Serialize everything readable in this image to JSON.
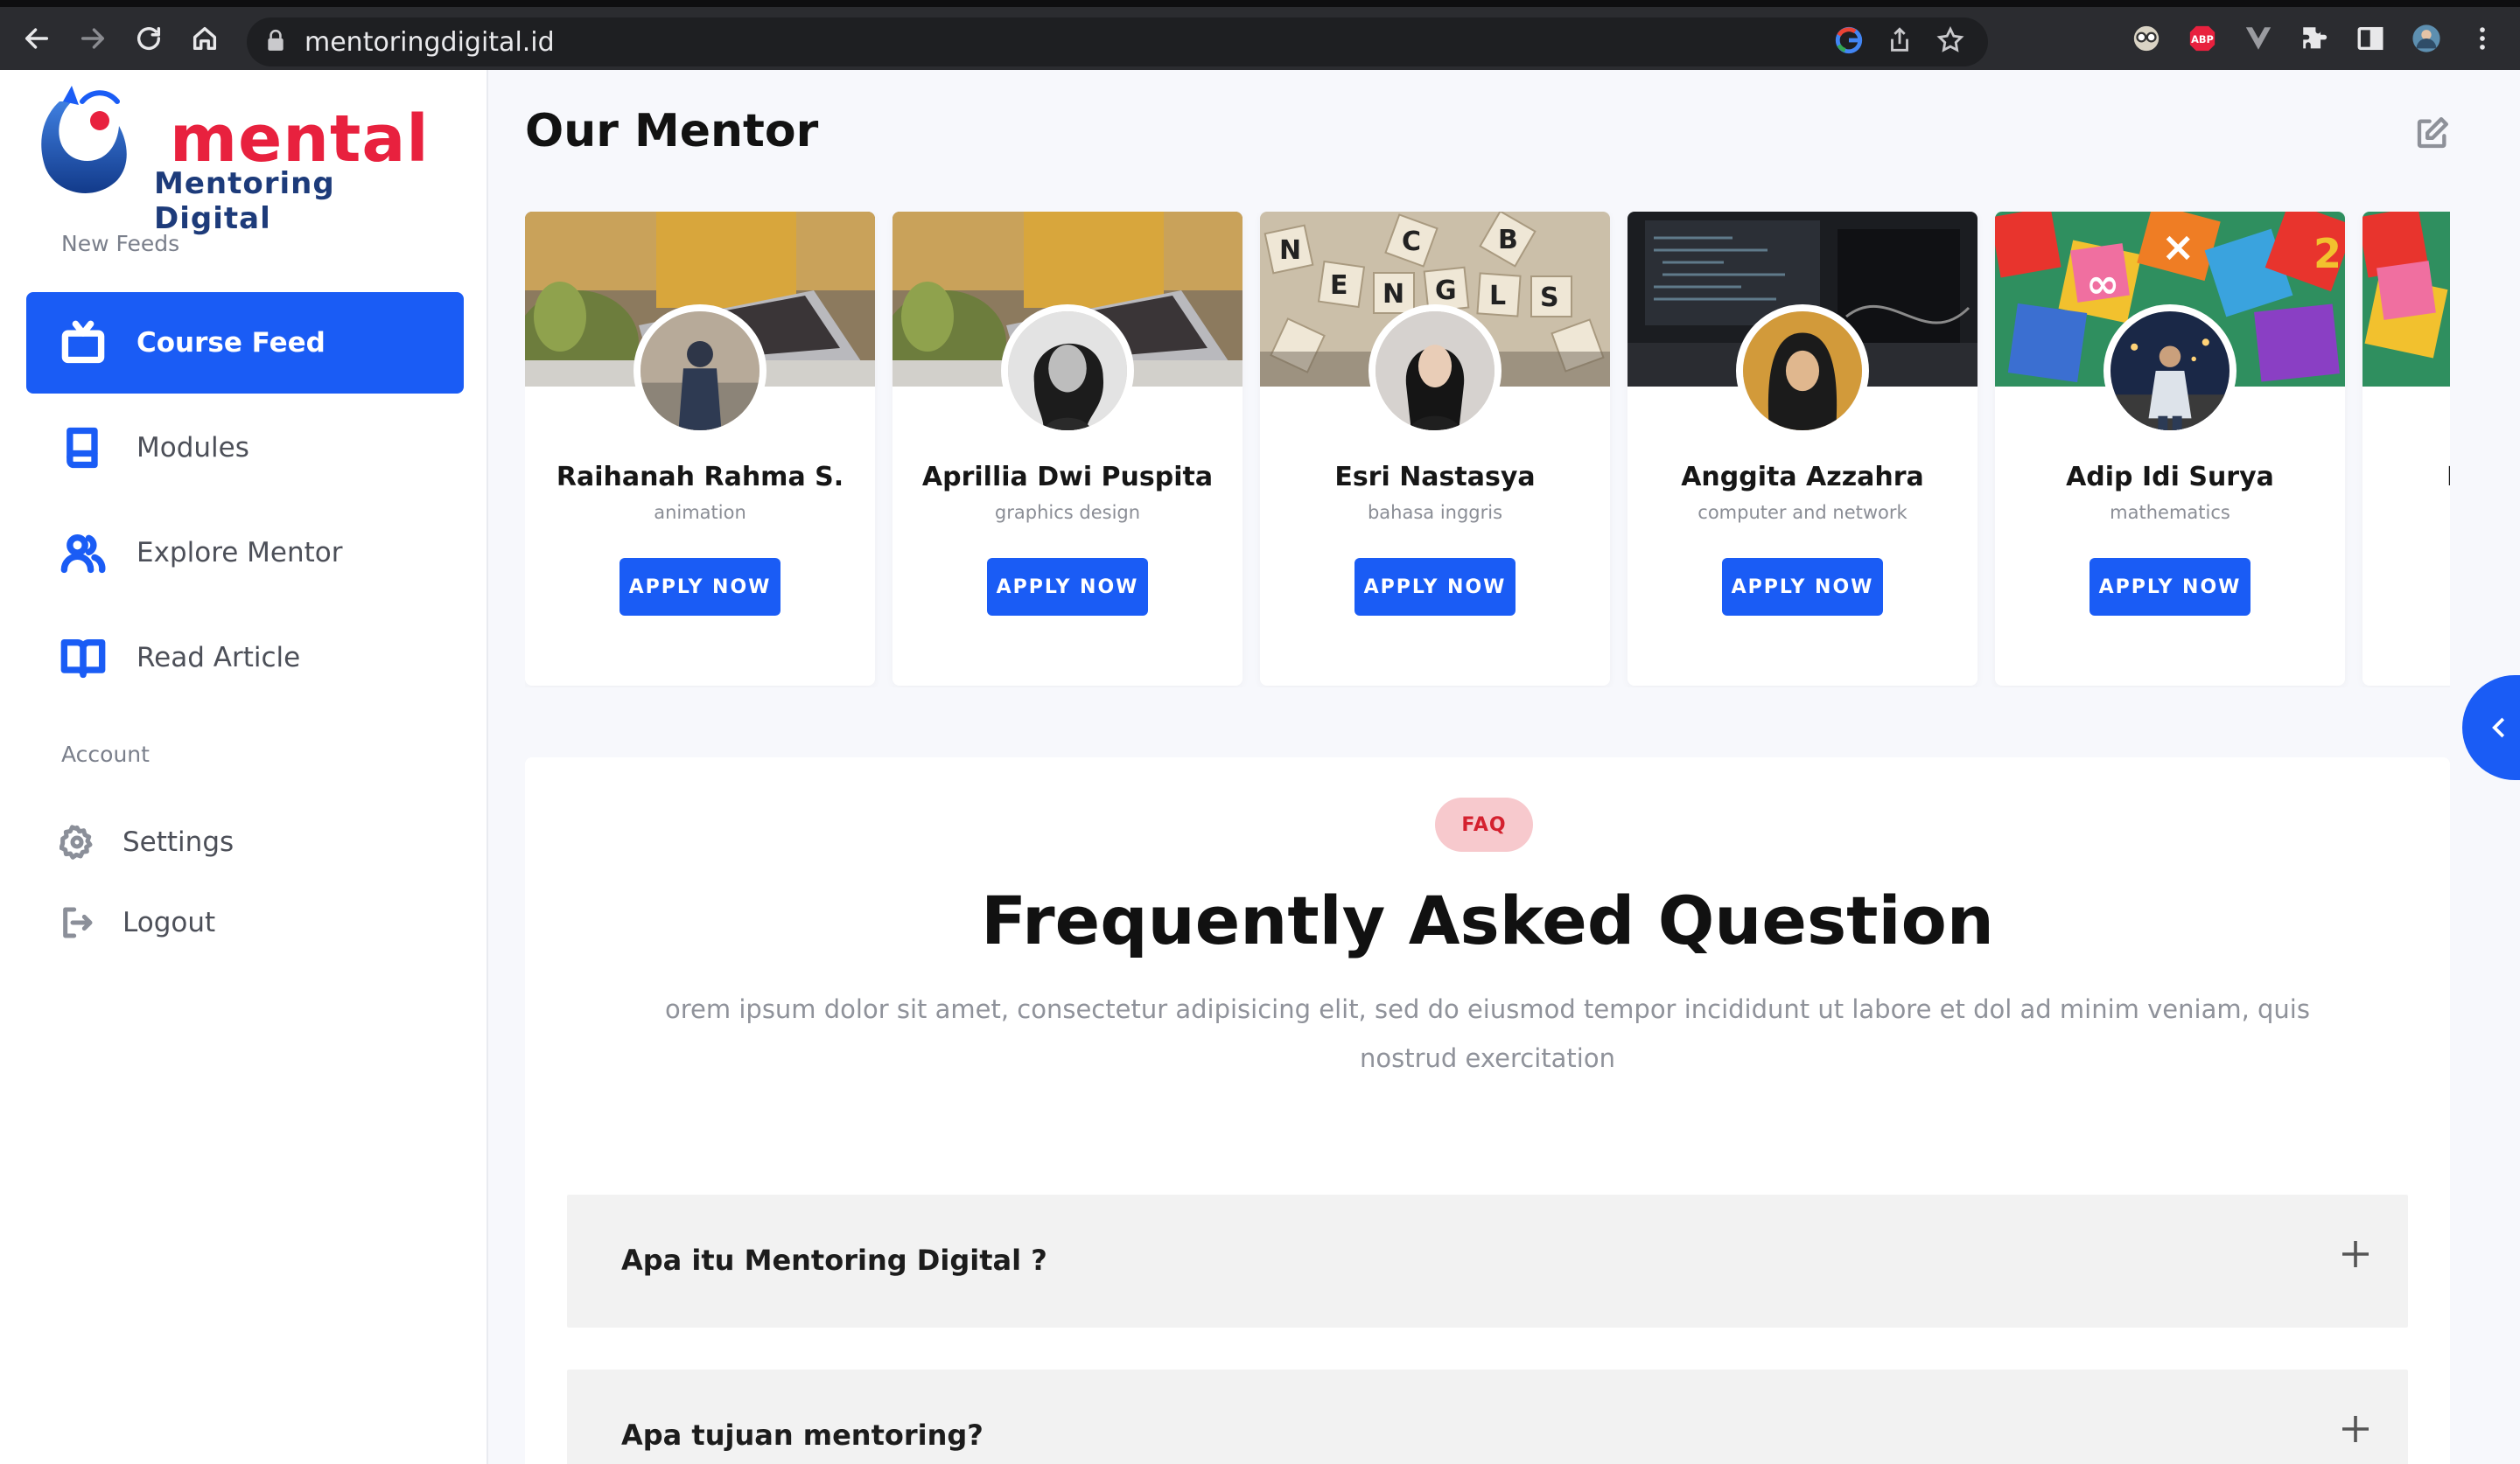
{
  "browser": {
    "url": "mentoringdigital.id"
  },
  "sidebar": {
    "logo": {
      "word": "mental",
      "sub": "Mentoring Digital"
    },
    "sections": [
      {
        "label": "New Feeds"
      },
      {
        "label": "Account"
      }
    ],
    "feeds": [
      {
        "label": "Course Feed",
        "icon": "tv-icon",
        "active": true
      },
      {
        "label": "Modules",
        "icon": "book-icon",
        "active": false
      },
      {
        "label": "Explore Mentor",
        "icon": "users-icon",
        "active": false
      },
      {
        "label": "Read Article",
        "icon": "open-book-icon",
        "active": false
      }
    ],
    "account": [
      {
        "label": "Settings",
        "icon": "gear-icon"
      },
      {
        "label": "Logout",
        "icon": "logout-icon"
      }
    ]
  },
  "main": {
    "title_light": "Our ",
    "title_bold": "Mentor",
    "mentors": [
      {
        "name": "Raihanah Rahma S.",
        "field": "animation",
        "button": "APPLY NOW"
      },
      {
        "name": "Aprillia Dwi Puspita",
        "field": "graphics design",
        "button": "APPLY NOW"
      },
      {
        "name": "Esri Nastasya",
        "field": "bahasa inggris",
        "button": "APPLY NOW"
      },
      {
        "name": "Anggita Azzahra",
        "field": "computer and network",
        "button": "APPLY NOW"
      },
      {
        "name": "Adip Idi Surya",
        "field": "mathematics",
        "button": "APPLY NOW"
      },
      {
        "name": "I",
        "field": "",
        "button": ""
      }
    ]
  },
  "faq": {
    "badge": "FAQ",
    "heading": "Frequently Asked Question",
    "description": "orem ipsum dolor sit amet, consectetur adipisicing elit, sed do eiusmod tempor incididunt ut labore et dol ad minim veniam, quis nostrud exercitation",
    "items": [
      {
        "question": "Apa itu Mentoring Digital ?"
      },
      {
        "question": "Apa tujuan mentoring?"
      }
    ]
  },
  "colors": {
    "primary": "#1a5cf5",
    "brand_red": "#e8213e",
    "brand_navy": "#1d3b7a",
    "faq_badge_bg": "#f7c9cd",
    "faq_badge_text": "#d4212f"
  }
}
